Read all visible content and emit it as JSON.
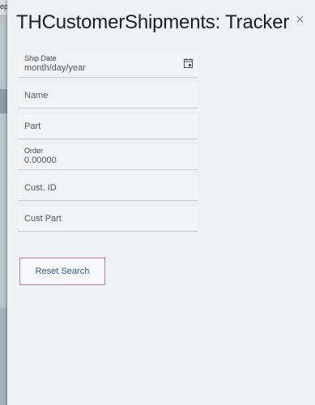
{
  "background": {
    "clipped_text": "ep"
  },
  "panel": {
    "title": "THCustomerShipments: Tracker",
    "close_symbol": "×",
    "close_icon": "close-icon"
  },
  "fields": {
    "ship_date": {
      "label": "Ship Date",
      "value": "month/day/year",
      "icon": "calendar-icon"
    },
    "name": {
      "placeholder": "Name"
    },
    "part": {
      "placeholder": "Part"
    },
    "order": {
      "label": "Order",
      "value": "0.00000"
    },
    "cust_id": {
      "placeholder": "Cust. ID"
    },
    "cust_part": {
      "placeholder": "Cust Part"
    }
  },
  "actions": {
    "reset_label": "Reset Search"
  },
  "colors": {
    "panel_bg": "#eff2f5",
    "button_border": "#c47ba0",
    "button_text": "#2f5e85"
  }
}
